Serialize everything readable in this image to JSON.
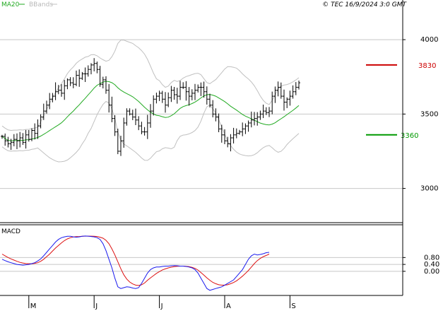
{
  "header": {
    "legend_ma": "MA20",
    "legend_bb": "BBands",
    "copyright": "© TEC 16/9/2024 3:0 GMT"
  },
  "colors": {
    "ma": "#22aa22",
    "bbands": "#c0c0c0",
    "bars": "#000000",
    "macd": "#1a1aee",
    "signal": "#dd1111",
    "resistance": "#cc0000",
    "support": "#009900",
    "grid": "#c8c8c8",
    "frame": "#000000"
  },
  "chart_data": [
    {
      "type": "bar",
      "name": "price",
      "ylim": [
        2770,
        4200
      ],
      "yticks": [
        {
          "value": 4000,
          "label": "4000"
        },
        {
          "value": 3500,
          "label": "3500"
        },
        {
          "value": 3000,
          "label": "3000"
        }
      ],
      "month_ticks": [
        {
          "index": 9,
          "label": "M"
        },
        {
          "index": 31,
          "label": "J"
        },
        {
          "index": 53,
          "label": "J"
        },
        {
          "index": 75,
          "label": "A"
        },
        {
          "index": 97,
          "label": "S"
        }
      ],
      "n_slots": 126,
      "closes": [
        3350,
        3320,
        3300,
        3310,
        3330,
        3320,
        3340,
        3310,
        3360,
        3330,
        3390,
        3370,
        3420,
        3480,
        3520,
        3560,
        3600,
        3620,
        3650,
        3660,
        3640,
        3690,
        3730,
        3710,
        3700,
        3760,
        3740,
        3770,
        3770,
        3800,
        3830,
        3840,
        3800,
        3700,
        3730,
        3660,
        3560,
        3470,
        3380,
        3250,
        3320,
        3440,
        3520,
        3500,
        3480,
        3460,
        3420,
        3380,
        3380,
        3440,
        3520,
        3600,
        3620,
        3640,
        3600,
        3560,
        3610,
        3660,
        3630,
        3620,
        3680,
        3680,
        3650,
        3620,
        3640,
        3660,
        3680,
        3680,
        3650,
        3600,
        3560,
        3500,
        3480,
        3400,
        3360,
        3320,
        3300,
        3340,
        3360,
        3370,
        3380,
        3400,
        3420,
        3440,
        3460,
        3470,
        3480,
        3500,
        3520,
        3510,
        3520,
        3620,
        3660,
        3680,
        3620,
        3580,
        3600,
        3620,
        3650,
        3680,
        3710
      ],
      "levels": [
        {
          "name": "resistance",
          "value": 3830,
          "label": "3830"
        },
        {
          "name": "support",
          "value": 3360,
          "label": "3360"
        }
      ]
    },
    {
      "type": "line",
      "name": "MACD",
      "title": "MACD",
      "ylim": [
        -140,
        270
      ],
      "yticks": [
        {
          "value": 80,
          "label": "0.80"
        },
        {
          "value": 40,
          "label": "0.40"
        },
        {
          "value": 0,
          "label": "0.00"
        }
      ],
      "series": [
        {
          "name": "MACD",
          "values": [
            70,
            62,
            55,
            50,
            45,
            40,
            38,
            36,
            38,
            40,
            45,
            50,
            60,
            72,
            90,
            110,
            130,
            150,
            170,
            185,
            195,
            200,
            203,
            203,
            200,
            198,
            200,
            203,
            205,
            204,
            202,
            200,
            195,
            185,
            160,
            120,
            70,
            20,
            -40,
            -90,
            -100,
            -95,
            -90,
            -92,
            -97,
            -100,
            -95,
            -70,
            -40,
            -10,
            10,
            20,
            25,
            25,
            28,
            30,
            30,
            32,
            33,
            32,
            30,
            30,
            28,
            25,
            20,
            10,
            -10,
            -40,
            -70,
            -100,
            -110,
            -105,
            -100,
            -95,
            -90,
            -80,
            -70,
            -60,
            -50,
            -30,
            -10,
            10,
            40,
            70,
            90,
            100,
            95,
            98,
            102,
            108,
            110
          ]
        },
        {
          "name": "Signal",
          "values": [
            100,
            90,
            80,
            72,
            65,
            58,
            52,
            48,
            45,
            44,
            44,
            46,
            50,
            58,
            70,
            85,
            100,
            118,
            135,
            150,
            165,
            178,
            188,
            195,
            199,
            201,
            202,
            203,
            204,
            204,
            204,
            203,
            202,
            198,
            192,
            180,
            160,
            130,
            95,
            55,
            15,
            -20,
            -45,
            -62,
            -73,
            -80,
            -82,
            -78,
            -68,
            -52,
            -38,
            -25,
            -12,
            -2,
            8,
            14,
            20,
            24,
            27,
            29,
            30,
            30,
            29,
            27,
            23,
            17,
            7,
            -7,
            -22,
            -38,
            -52,
            -64,
            -72,
            -78,
            -80,
            -80,
            -78,
            -72,
            -65,
            -55,
            -42,
            -28,
            -12,
            5,
            25,
            45,
            62,
            75,
            85,
            92,
            100
          ]
        }
      ]
    }
  ]
}
